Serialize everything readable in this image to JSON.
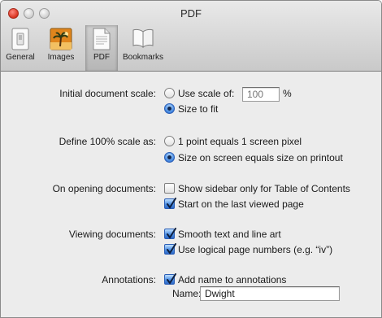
{
  "window": {
    "title": "PDF"
  },
  "toolbar": {
    "items": [
      {
        "label": "General",
        "icon": "light-switch-icon"
      },
      {
        "label": "Images",
        "icon": "palm-tree-photo-icon"
      },
      {
        "label": "PDF",
        "icon": "pdf-document-icon",
        "selected": true
      },
      {
        "label": "Bookmarks",
        "icon": "open-book-icon"
      }
    ]
  },
  "settings": {
    "initial_scale": {
      "label": "Initial document scale:",
      "use_scale_label": "Use scale of:",
      "scale_value": "",
      "scale_placeholder": "100",
      "percent": "%",
      "size_to_fit_label": "Size to fit",
      "selected": "size_to_fit"
    },
    "define_scale": {
      "label": "Define 100% scale as:",
      "option1": "1 point equals 1 screen pixel",
      "option2": "Size on screen equals size on printout",
      "selected": "option2"
    },
    "opening": {
      "label": "On opening documents:",
      "show_sidebar": "Show sidebar only for Table of Contents",
      "show_sidebar_checked": false,
      "start_last": "Start on the last viewed page",
      "start_last_checked": true
    },
    "viewing": {
      "label": "Viewing documents:",
      "smooth": "Smooth text and line art",
      "smooth_checked": true,
      "logical": "Use logical page numbers (e.g. “iv”)",
      "logical_checked": true
    },
    "annotations": {
      "label": "Annotations:",
      "add_name": "Add name to annotations",
      "add_name_checked": true,
      "name_label": "Name:",
      "name_value": "Dwight"
    }
  },
  "colors": {
    "accent": "#4c8fe4",
    "close_button": "#d8321f"
  }
}
